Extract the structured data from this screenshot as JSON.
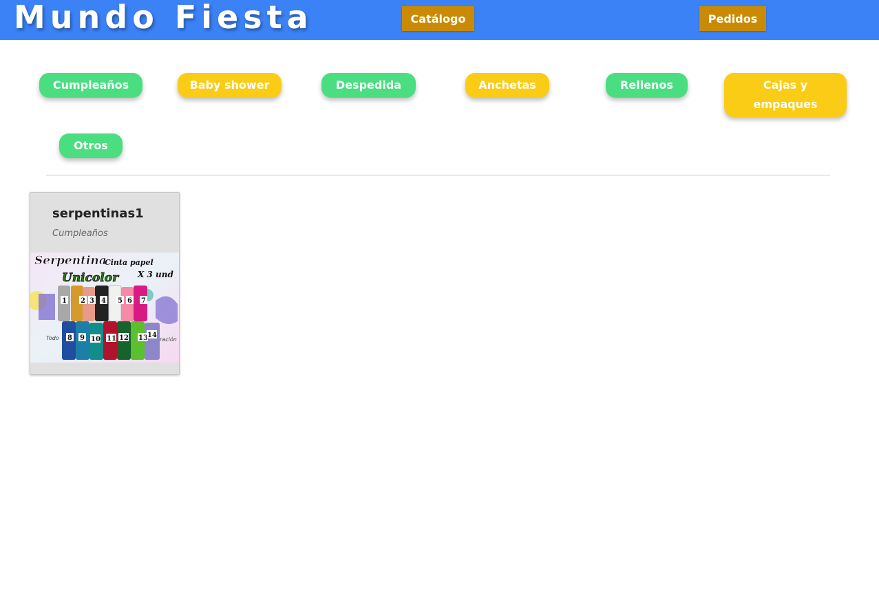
{
  "header": {
    "brand": "Mundo Fiesta",
    "nav": {
      "catalog": "Catálogo",
      "orders": "Pedidos"
    }
  },
  "categories": [
    {
      "label": "Cumpleaños",
      "color": "#4ade80"
    },
    {
      "label": "Baby shower",
      "color": "#facc15"
    },
    {
      "label": "Despedida",
      "color": "#4ade80"
    },
    {
      "label": "Anchetas",
      "color": "#facc15"
    },
    {
      "label": "Rellenos",
      "color": "#4ade80"
    },
    {
      "label": "Cajas y empaques",
      "color": "#facc15"
    },
    {
      "label": "Otros",
      "color": "#4ade80"
    }
  ],
  "products": [
    {
      "name": "serpentinas1",
      "category": "Cumpleaños",
      "image": {
        "line1": "Serpentina",
        "line1b": "Cinta papel",
        "line2": "Unicolor",
        "line2b": "X 3 und",
        "numbers": [
          "1",
          "2",
          "3",
          "4",
          "5",
          "6",
          "7",
          "8",
          "9",
          "10",
          "11",
          "12",
          "13",
          "14"
        ],
        "side_text_left": "Todo",
        "side_text_right": "ración"
      }
    }
  ],
  "colors": {
    "header_bg": "#3b82f6",
    "nav_btn_bg": "#ca8a04",
    "green": "#4ade80",
    "yellow": "#facc15"
  }
}
